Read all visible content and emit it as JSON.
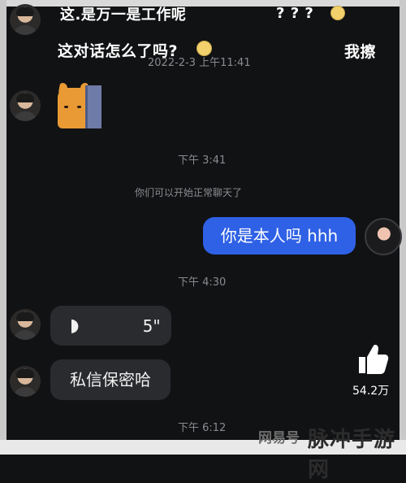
{
  "overlay_line1": "这.是万一是工作呢",
  "overlay_marks": "? ? ?",
  "overlay_line2": "这对话怎么了吗?",
  "overlay_right": "我擦",
  "date_time": "2022-2-3 上午11:41",
  "messages": [
    {
      "type": "sticker",
      "sender": "received",
      "name": "cat-peeking-sticker"
    },
    {
      "type": "time",
      "text": "下午 3:41"
    },
    {
      "type": "system",
      "text": "你们可以开始正常聊天了"
    },
    {
      "type": "text",
      "sender": "sent",
      "text": "你是本人吗 hhh"
    },
    {
      "type": "time",
      "text": "下午 4:30"
    },
    {
      "type": "voice",
      "sender": "received",
      "duration": "5\""
    },
    {
      "type": "text",
      "sender": "received",
      "text": "私信保密哈"
    },
    {
      "type": "time",
      "text": "下午 6:12"
    }
  ],
  "icons": {
    "voice": "sound-wave-icon",
    "like": "thumbs-up-icon",
    "emoji": "emoji-face-icon"
  },
  "like_count": "54.2万",
  "watermark": {
    "logo": "网易号",
    "text": "脉冲手游网"
  },
  "colors": {
    "background": "#111214",
    "sent_bubble": "#2f61e6",
    "received_bubble": "#2a2b2f"
  }
}
